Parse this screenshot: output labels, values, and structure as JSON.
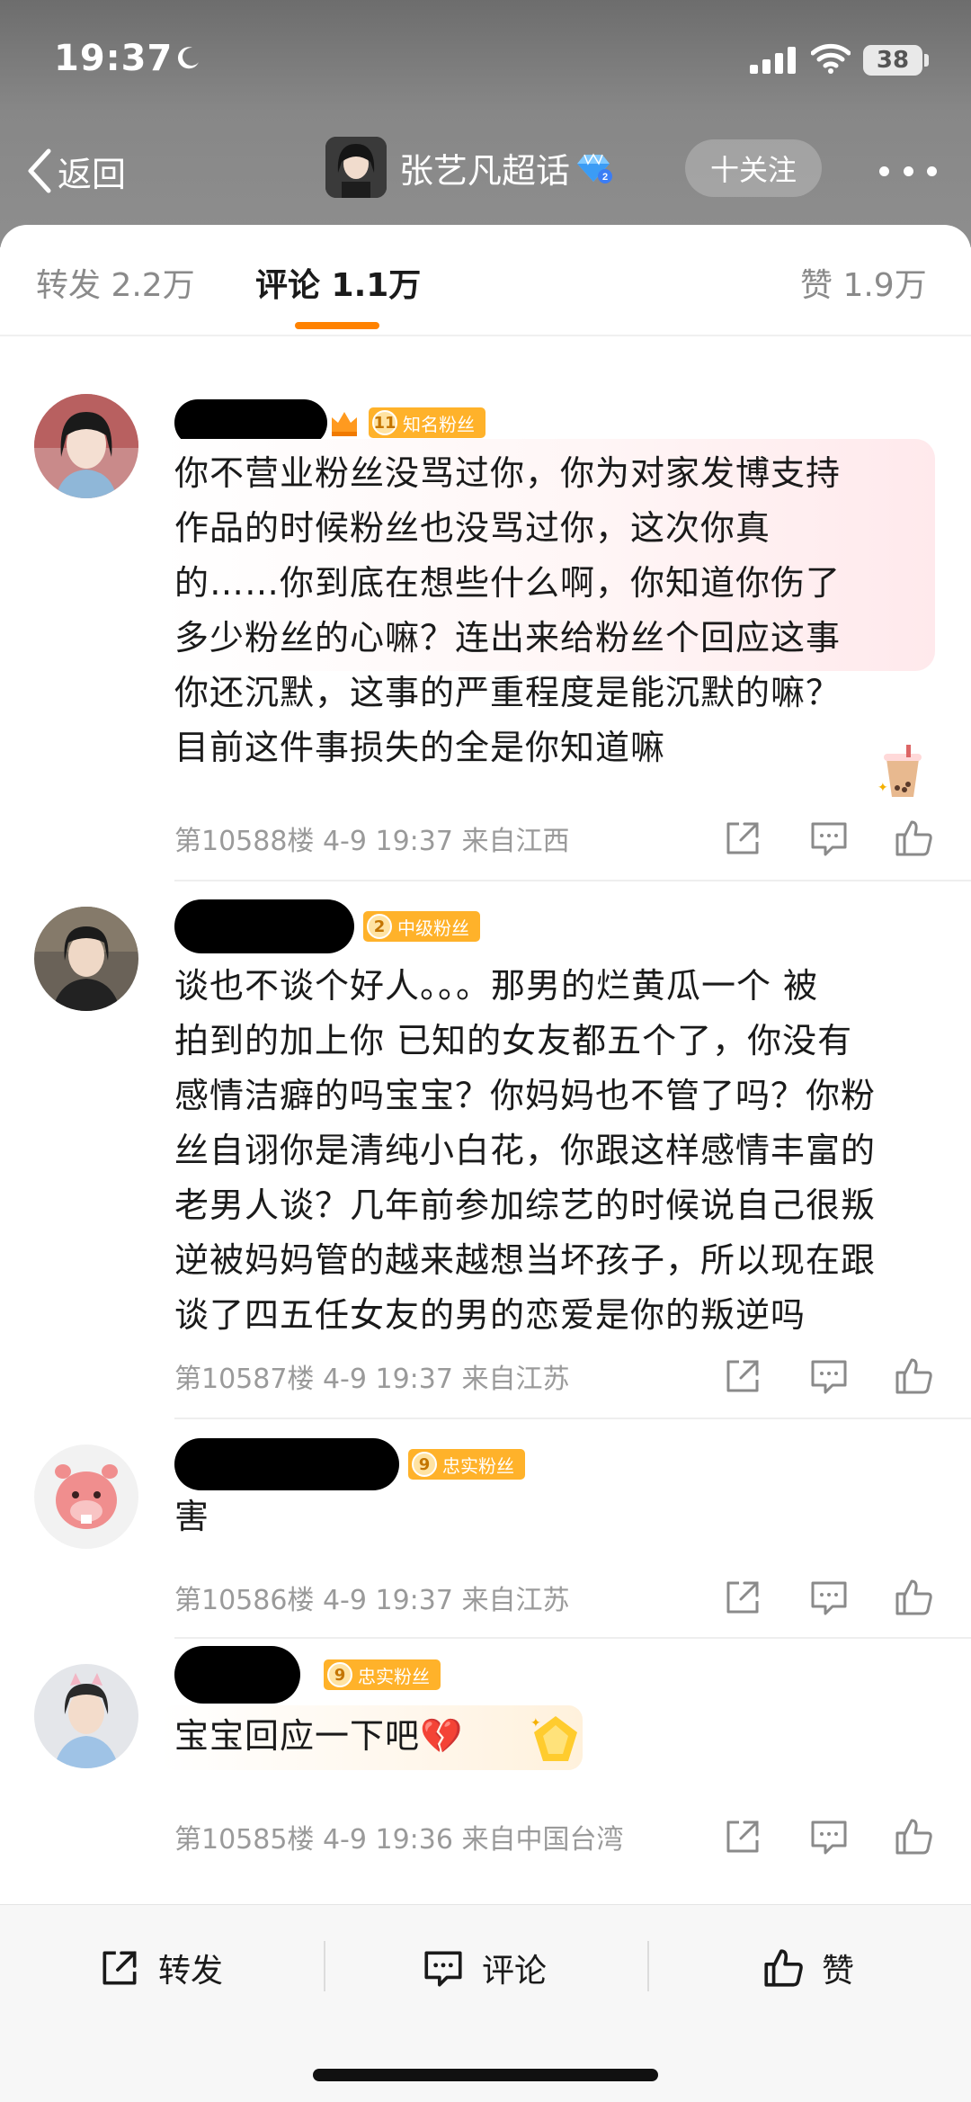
{
  "status_bar": {
    "time": "19:37",
    "battery": "38"
  },
  "nav": {
    "back_label": "返回",
    "title": "张艺凡超话",
    "follow_label": "十关注"
  },
  "tabs": {
    "repost": "转发 2.2万",
    "comments": "评论 1.1万",
    "likes": "赞 1.9万"
  },
  "comments": [
    {
      "badge_level": "11",
      "badge_label": "知名粉丝",
      "lines": [
        "你不营业粉丝没骂过你，你为对家发博支持",
        "作品的时候粉丝也没骂过你，这次你真",
        "的……你到底在想些什么啊，你知道你伤了",
        "多少粉丝的心嘛？连出来给粉丝个回应这事",
        "你还沉默，这事的严重程度是能沉默的嘛？",
        "目前这件事损失的全是你知道嘛"
      ],
      "meta": "第10588楼 4-9 19:37 来自江西"
    },
    {
      "badge_level": "2",
      "badge_label": "中级粉丝",
      "lines": [
        "谈也不谈个好人。。。那男的烂黄瓜一个 被",
        "拍到的加上你 已知的女友都五个了，你没有",
        "感情洁癖的吗宝宝？你妈妈也不管了吗？你粉",
        "丝自诩你是清纯小白花，你跟这样感情丰富的",
        "老男人谈？几年前参加综艺的时候说自己很叛",
        "逆被妈妈管的越来越想当坏孩子，所以现在跟",
        "谈了四五任女友的男的恋爱是你的叛逆吗"
      ],
      "meta": "第10587楼 4-9 19:37 来自江苏"
    },
    {
      "badge_level": "9",
      "badge_label": "忠实粉丝",
      "lines": [
        "害"
      ],
      "meta": "第10586楼 4-9 19:37 来自江苏"
    },
    {
      "badge_level": "9",
      "badge_label": "忠实粉丝",
      "lines": [
        "宝宝回应一下吧💔"
      ],
      "meta": "第10585楼 4-9 19:36 来自中国台湾"
    }
  ],
  "toolbar": {
    "repost": "转发",
    "comment": "评论",
    "like": "赞"
  },
  "colors": {
    "accent": "#ff8200",
    "badge": "#ffb22a"
  }
}
